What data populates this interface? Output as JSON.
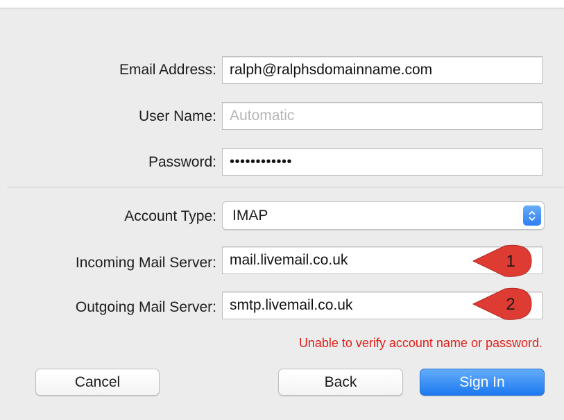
{
  "form": {
    "email_label": "Email Address:",
    "email_value": "ralph@ralphsdomainname.com",
    "username_label": "User Name:",
    "username_placeholder": "Automatic",
    "password_label": "Password:",
    "password_value": "••••••••••••",
    "account_type_label": "Account Type:",
    "account_type_value": "IMAP",
    "incoming_label": "Incoming Mail Server:",
    "incoming_value": "mail.livemail.co.uk",
    "outgoing_label": "Outgoing Mail Server:",
    "outgoing_value": "smtp.livemail.co.uk",
    "error_message": "Unable to verify account name or password."
  },
  "buttons": {
    "cancel": "Cancel",
    "back": "Back",
    "sign_in": "Sign In"
  },
  "annotations": {
    "callout_1": "1",
    "callout_2": "2"
  },
  "colors": {
    "accent": "#1d79f0",
    "error": "#e0201a",
    "callout": "#de3b33"
  },
  "icons": {
    "select_stepper": "up-down-chevron-icon"
  }
}
